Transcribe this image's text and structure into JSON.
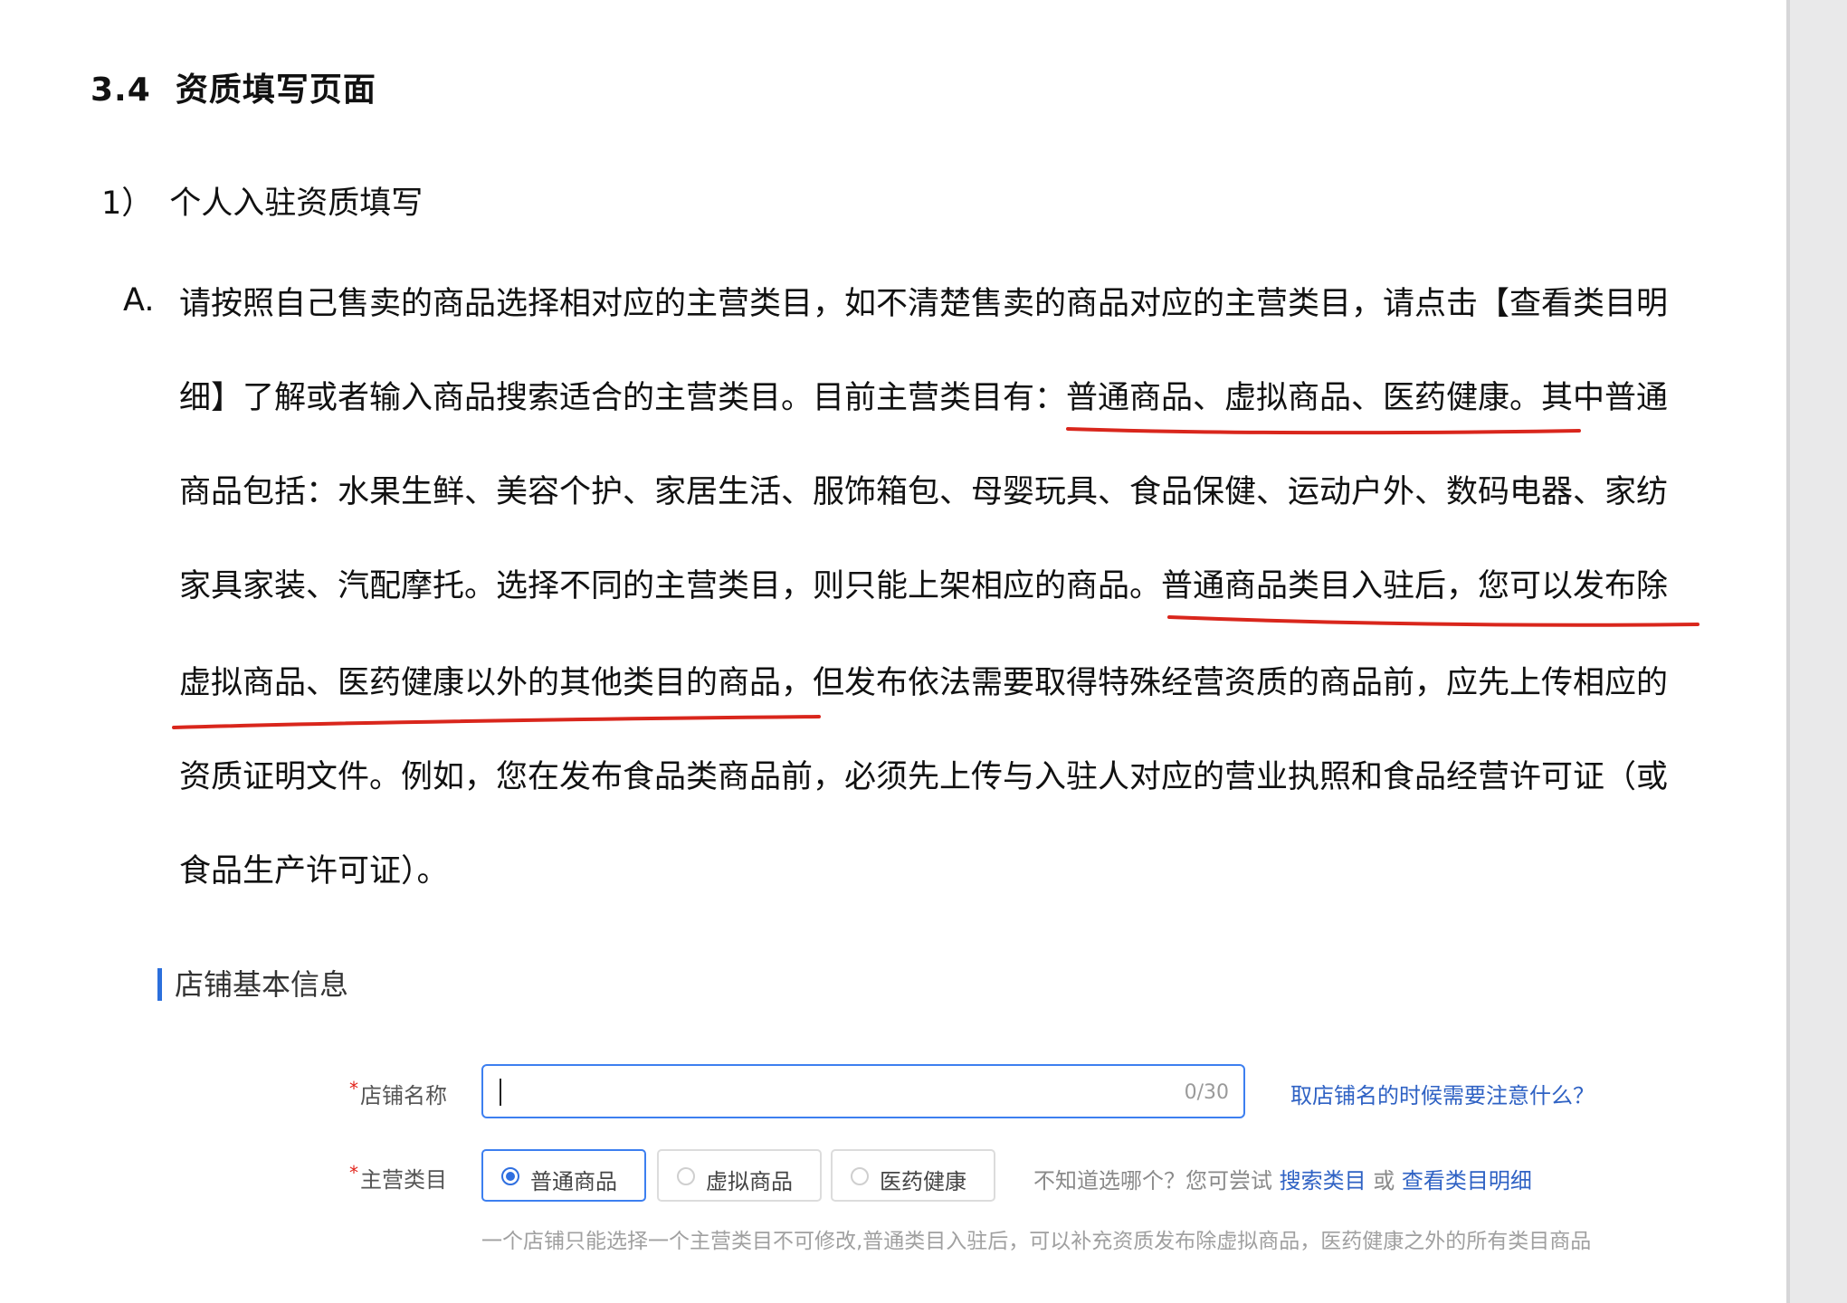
{
  "section": {
    "number": "3.4",
    "title": "资质填写页面"
  },
  "subsection": {
    "number": "1）",
    "title": "个人入驻资质填写"
  },
  "paragraph": {
    "marker": "A.",
    "lines": [
      "请按照自己售卖的商品选择相对应的主营类目，如不清楚售卖的商品对应的主营类目，请点击【查看类目明",
      "细】了解或者输入商品搜索适合的主营类目。目前主营类目有：普通商品、虚拟商品、医药健康。其中普通",
      "商品包括：水果生鲜、美容个护、家居生活、服饰箱包、母婴玩具、食品保健、运动户外、数码电器、家纺",
      "家具家装、汽配摩托。选择不同的主营类目，则只能上架相应的商品。普通商品类目入驻后，您可以发布除",
      "虚拟商品、医药健康以外的其他类目的商品，但发布依法需要取得特殊经营资质的商品前，应先上传相应的",
      "资质证明文件。例如，您在发布食品类商品前，必须先上传与入驻人对应的营业执照和食品经营许可证（或",
      "食品生产许可证）。"
    ]
  },
  "form": {
    "card_title": "店铺基本信息",
    "store_name": {
      "required_mark": "*",
      "label": "店铺名称",
      "value": "",
      "counter": "0/30",
      "help_link": "取店铺名的时候需要注意什么？"
    },
    "main_category": {
      "required_mark": "*",
      "label": "主营类目",
      "options": [
        {
          "label": "普通商品",
          "selected": true
        },
        {
          "label": "虚拟商品",
          "selected": false
        },
        {
          "label": "医药健康",
          "selected": false
        }
      ],
      "hint_prefix": "不知道选哪个？您可尝试",
      "hint_link_search": "搜索类目",
      "hint_or": "或",
      "hint_link_detail": "查看类目明细",
      "note": "一个店铺只能选择一个主营类目不可修改,普通类目入驻后，可以补充资质发布除虚拟商品，医药健康之外的所有类目商品"
    }
  },
  "colors": {
    "underline": "#d9261c",
    "accent": "#3d7ff0",
    "link": "#2f62c4"
  }
}
